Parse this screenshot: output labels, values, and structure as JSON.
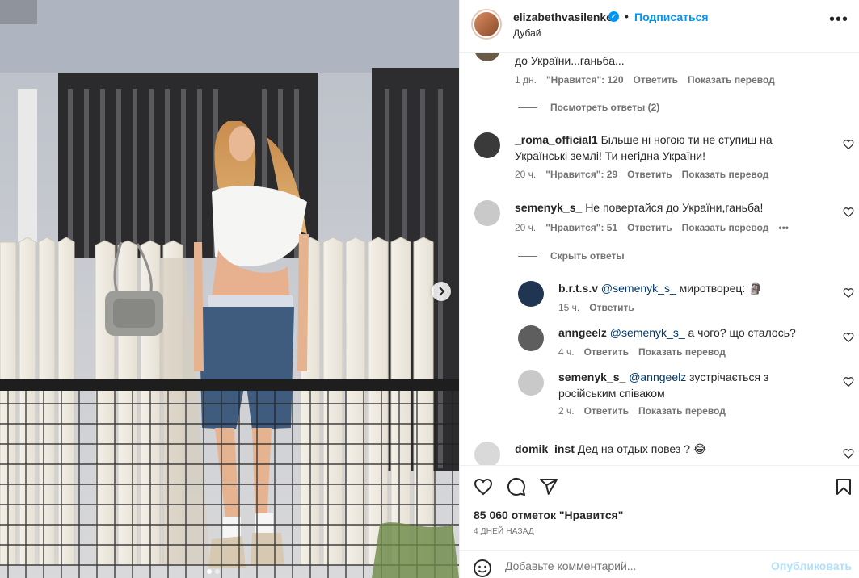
{
  "header": {
    "username": "elizabethvasilenko",
    "separator": "•",
    "follow_label": "Подписаться",
    "location": "Дубай",
    "more_icon": "more-horizontal-icon"
  },
  "comments": {
    "c0": {
      "text": "до України...ганьба...",
      "time": "1 дн.",
      "likes": "\"Нравится\": 120",
      "reply": "Ответить",
      "translate": "Показать перевод",
      "view_replies": "Посмотреть ответы (2)"
    },
    "c1": {
      "username": "_roma_official1",
      "text": "Більше ні ногою ти не ступиш на Українські землі! Ти негідна України!",
      "time": "20 ч.",
      "likes": "\"Нравится\": 29",
      "reply": "Ответить",
      "translate": "Показать перевод"
    },
    "c2": {
      "username": "semenyk_s_",
      "text": "Не повертайся до України,ганьба!",
      "time": "20 ч.",
      "likes": "\"Нравится\": 51",
      "reply": "Ответить",
      "translate": "Показать перевод",
      "more": "•••",
      "hide_replies": "Скрыть ответы"
    },
    "r1": {
      "username": "b.r.t.s.v",
      "mention": "@semenyk_s_",
      "text": "миротворец: 🗿",
      "time": "15 ч.",
      "reply": "Ответить"
    },
    "r2": {
      "username": "anngeelz",
      "mention": "@semenyk_s_",
      "text": "а чого? що сталось?",
      "time": "4 ч.",
      "reply": "Ответить",
      "translate": "Показать перевод"
    },
    "r3": {
      "username": "semenyk_s_",
      "mention": "@anngeelz",
      "text": "зустрічається з російським співаком",
      "time": "2 ч.",
      "reply": "Ответить",
      "translate": "Показать перевод"
    },
    "c3": {
      "username": "domik_inst",
      "text": "Дед на отдых повез ? 😂"
    }
  },
  "actions": {
    "likes_count": "85 060 отметок \"Нравится\"",
    "posted_ago": "4 ДНЕЙ НАЗАД",
    "comment_placeholder": "Добавьте комментарий...",
    "publish_label": "Опубликовать",
    "icons": [
      "heart-icon",
      "comment-icon",
      "share-icon",
      "bookmark-icon",
      "emoji-icon"
    ]
  },
  "carousel": {
    "next_icon": "chevron-right-icon",
    "slide_index": 1,
    "slide_count": 2
  }
}
